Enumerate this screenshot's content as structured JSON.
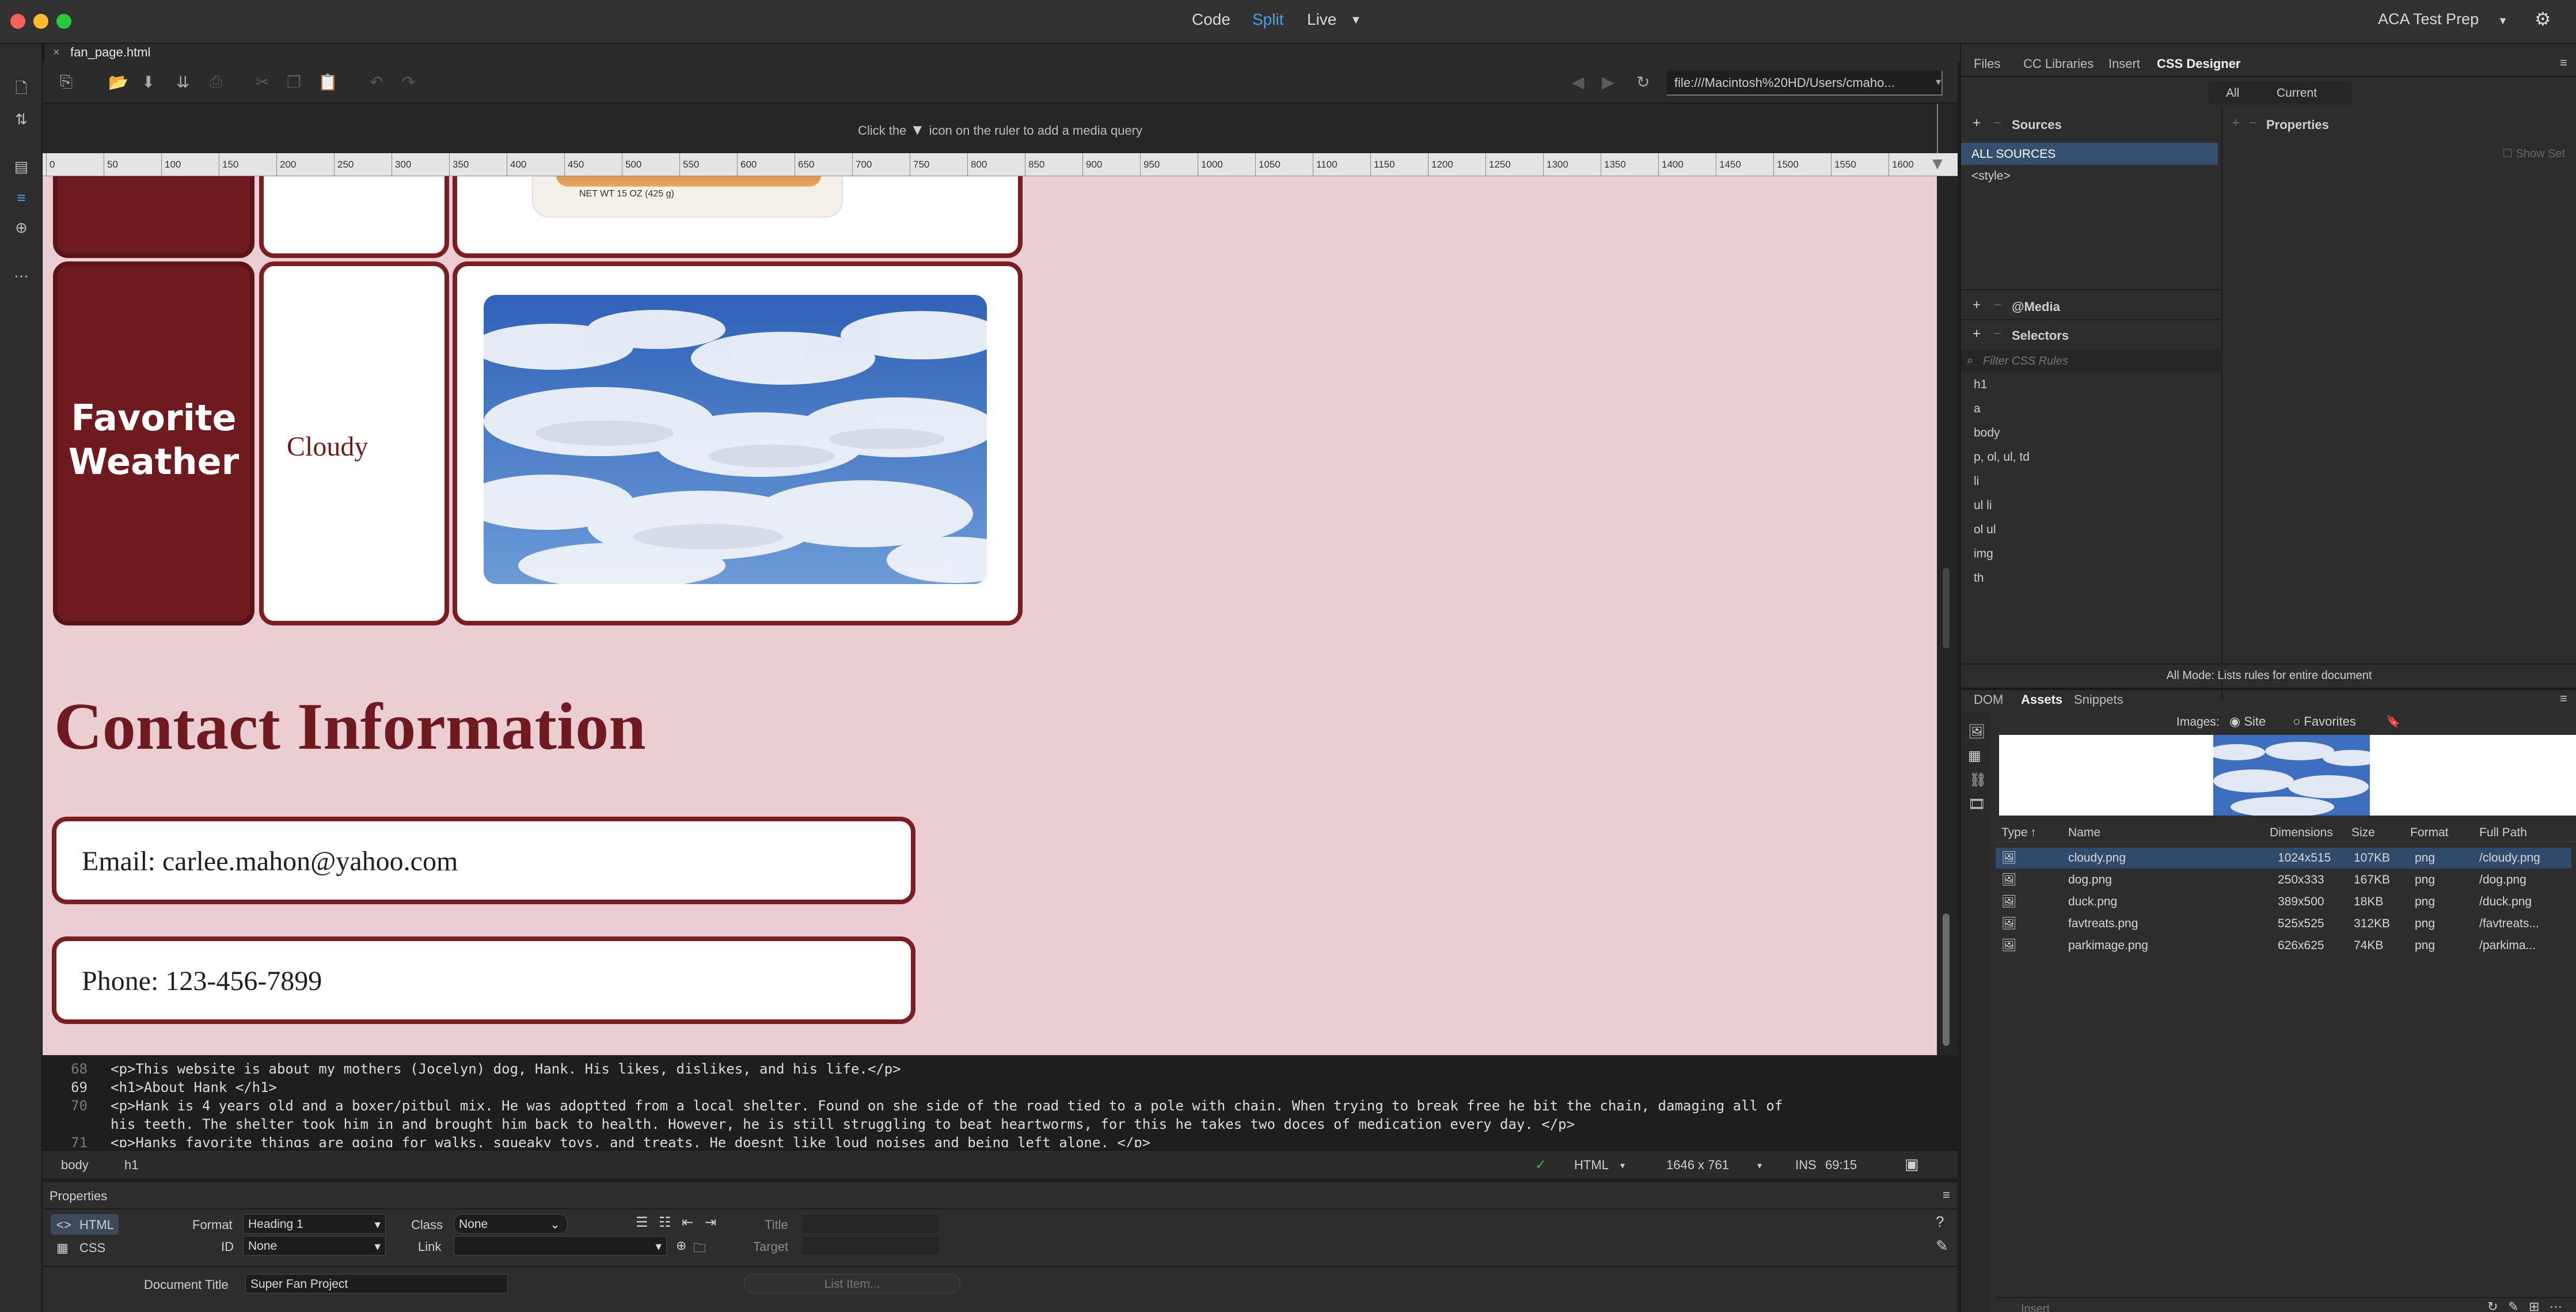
{
  "titlebar": {
    "modes": [
      "Code",
      "Split",
      "Live"
    ],
    "active_mode": "Split",
    "workspace": "ACA Test Prep",
    "traffic_colors": [
      "#fe5f57",
      "#febc2e",
      "#28c840"
    ]
  },
  "document_tab": {
    "filename": "fan_page.html"
  },
  "toolbar": {
    "url": "file:///Macintosh%20HD/Users/cmaho..."
  },
  "media_query_bar": {
    "message_before": "Click the",
    "message_after": "icon on the ruler to add a media query"
  },
  "ruler": {
    "ticks": [
      "0",
      "50",
      "100",
      "150",
      "200",
      "250",
      "300",
      "350",
      "400",
      "450",
      "500",
      "550",
      "600",
      "650",
      "700",
      "750",
      "800",
      "850",
      "900",
      "950",
      "1000",
      "1050",
      "1100",
      "1150",
      "1200",
      "1250",
      "1300",
      "1350",
      "1400",
      "1450",
      "1500",
      "1550",
      "1600"
    ]
  },
  "design": {
    "favorite_label": "Favorite Weather",
    "favorite_value": "Cloudy",
    "contact_title": "Contact Information",
    "email": "Email: carlee.mahon@yahoo.com",
    "phone": "Phone: 123-456-7899",
    "colors": {
      "maroon": "#7b1e22",
      "pink_bg": "#eaced1"
    }
  },
  "code": {
    "lines": [
      {
        "num": "68",
        "text": "<p>This website is about my mothers (Jocelyn) dog, Hank. His likes, dislikes, and his life.</p>"
      },
      {
        "num": "69",
        "text": "<h1>About Hank </h1>"
      },
      {
        "num": "70",
        "text": "<p>Hank is 4 years old and a boxer/pitbul mix. He was adoptted from a local shelter. Found on she side of the road tied to a pole with chain. When trying to break free he bit the chain, damaging all of"
      },
      {
        "num": "",
        "text": "his teeth. The shelter took him in and brought him back to health. However, he is still struggling to beat heartworms, for this he takes two doces of medication every day. </p>"
      },
      {
        "num": "71",
        "text": "<p>Hanks favorite things are going for walks, squeaky toys, and treats. He doesnt like loud noises and being left alone. </p>"
      }
    ]
  },
  "status": {
    "breadcrumbs": [
      "body",
      "h1"
    ],
    "doc_type": "HTML",
    "dimensions": "1646 x 761",
    "mode": "INS",
    "position": "69:15"
  },
  "properties": {
    "title": "Properties",
    "html_tab": "HTML",
    "css_tab": "CSS",
    "format_label": "Format",
    "format_value": "Heading 1",
    "id_label": "ID",
    "id_value": "None",
    "class_label": "Class",
    "class_value": "None",
    "link_label": "Link",
    "title_label": "Title",
    "target_label": "Target",
    "doc_title_label": "Document Title",
    "doc_title_value": "Super Fan Project",
    "list_item_btn": "List Item..."
  },
  "right_panel": {
    "top_tabs": [
      "Files",
      "CC Libraries",
      "Insert",
      "CSS Designer"
    ],
    "active_top_tab": "CSS Designer",
    "subtabs": [
      "All",
      "Current"
    ],
    "sources_title": "Sources",
    "sources": [
      "ALL SOURCES",
      "<style>"
    ],
    "properties_title": "Properties",
    "show_set": "Show Set",
    "media_title": "@Media",
    "selectors_title": "Selectors",
    "filter_placeholder": "Filter CSS Rules",
    "selectors": [
      "h1",
      "a",
      "body",
      "p, ol, ul, td",
      "li",
      "ul li",
      "ol ul",
      "img",
      "th"
    ],
    "all_mode_msg": "All Mode: Lists rules for entire document",
    "bottom_tabs": [
      "DOM",
      "Assets",
      "Snippets"
    ],
    "active_bottom_tab": "Assets",
    "images_label": "Images:",
    "site_label": "Site",
    "favorites_label": "Favorites",
    "asset_headers": [
      "Type",
      "Name",
      "Dimensions",
      "Size",
      "Format",
      "Full Path"
    ],
    "assets": [
      {
        "name": "cloudy.png",
        "dims": "1024x515",
        "size": "107KB",
        "format": "png",
        "path": "/cloudy.png"
      },
      {
        "name": "dog.png",
        "dims": "250x333",
        "size": "167KB",
        "format": "png",
        "path": "/dog.png"
      },
      {
        "name": "duck.png",
        "dims": "389x500",
        "size": "18KB",
        "format": "png",
        "path": "/duck.png"
      },
      {
        "name": "favtreats.png",
        "dims": "525x525",
        "size": "312KB",
        "format": "png",
        "path": "/favtreats..."
      },
      {
        "name": "parkimage.png",
        "dims": "626x625",
        "size": "74KB",
        "format": "png",
        "path": "/parkima..."
      }
    ],
    "insert_btn": "Insert"
  }
}
